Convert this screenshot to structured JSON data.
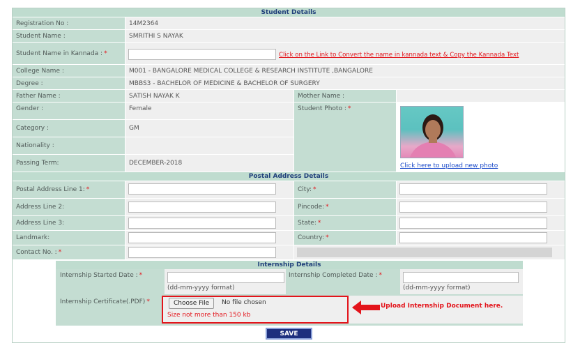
{
  "student_details": {
    "header": "Student Details",
    "registration_no_label": "Registration No :",
    "registration_no": "14M2364",
    "student_name_label": "Student Name :",
    "student_name": "SMRITHI S NAYAK",
    "kannada_name_label": "Student Name in Kannada :",
    "kannada_name_value": "",
    "kannada_link": "Click on the Link to Convert the name in kannada text & Copy the Kannada Text",
    "college_label": "College Name :",
    "college": "M001 - BANGALORE MEDICAL COLLEGE & RESEARCH INSTITUTE ,BANGALORE",
    "degree_label": "Degree :",
    "degree": "MBBS3 - BACHELOR OF MEDICINE & BACHELOR OF SURGERY",
    "father_label": "Father Name :",
    "father": "SATISH NAYAK K",
    "mother_label": "Mother Name :",
    "mother": "",
    "gender_label": "Gender :",
    "gender": "Female",
    "photo_label": "Student Photo :",
    "category_label": "Category :",
    "category": "GM",
    "nationality_label": "Nationality :",
    "nationality": "",
    "passing_label": "Passing Term:",
    "passing": "DECEMBER-2018",
    "upload_photo_link": "Click here to upload new photo",
    "required_mark": "*"
  },
  "postal": {
    "header": "Postal Address Details",
    "line1_label": "Postal Address Line 1:",
    "line2_label": "Address Line 2:",
    "line3_label": "Address Line 3:",
    "landmark_label": "Landmark:",
    "contact_label": "Contact No. :",
    "city_label": "City:",
    "pincode_label": "Pincode:",
    "state_label": "State:",
    "country_label": "Country:"
  },
  "internship": {
    "header": "Internship Details",
    "started_label": "Internship Started Date :",
    "completed_label": "Internship Completed Date :",
    "date_format": "(dd-mm-yyyy format)",
    "certificate_label": "Internship Certificate(.PDF)",
    "choose_file": "Choose File",
    "no_file": "No file chosen",
    "size_note": "Size not more than 150 kb",
    "annotation": "Upload Internship Document here."
  },
  "save_label": "SAVE",
  "colors": {
    "label_bg": "#c4ddd2",
    "value_bg": "#efefef",
    "header_text": "#1f3f7a",
    "required": "#e3141b",
    "link": "#1a4ac9",
    "save_bg": "#1e2f7e"
  }
}
